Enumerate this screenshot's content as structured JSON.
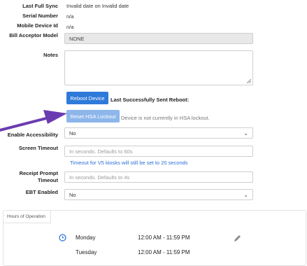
{
  "fields": {
    "last_full_sync": {
      "label": "Last Full Sync",
      "value": "Invalid date on Invalid date"
    },
    "serial_number": {
      "label": "Serial Number",
      "value": "n/a"
    },
    "mobile_device_id": {
      "label": "Mobile Device Id",
      "value": "n/a"
    },
    "bill_acceptor_model": {
      "label": "Bill Acceptor Model",
      "value": "NONE"
    },
    "notes": {
      "label": "Notes",
      "value": ""
    }
  },
  "reboot": {
    "button_label": "Reboot Device",
    "status_text": "Last Successfully Sent Reboot:"
  },
  "hsa": {
    "button_label": "Reset HSA Lockout",
    "status_text": "Device is not currently in HSA lockout."
  },
  "accessibility": {
    "label": "Enable Accessibility",
    "value": "No"
  },
  "screen_timeout": {
    "label": "Screen Timeout",
    "placeholder": "In seconds. Defaults to 60s",
    "hint": "Timeout for V5 kiosks will still be set to 20 seconds"
  },
  "receipt_prompt_timeout": {
    "label_line1": "Receipt Prompt",
    "label_line2": "Timeout",
    "placeholder": "In seconds. Defaults to 4s"
  },
  "ebt": {
    "label": "EBT Enabled",
    "value": "No"
  },
  "hours": {
    "tab_label": "Hours of Operation",
    "days": [
      {
        "day": "Monday",
        "hours": "12:00 AM - 11:59 PM"
      },
      {
        "day": "Tuesday",
        "hours": "12:00 AM - 11:59 PM"
      }
    ]
  },
  "colors": {
    "primary_button": "#2f7ad9",
    "disabled_button": "#8db6ea",
    "arrow": "#6a3bb0"
  }
}
